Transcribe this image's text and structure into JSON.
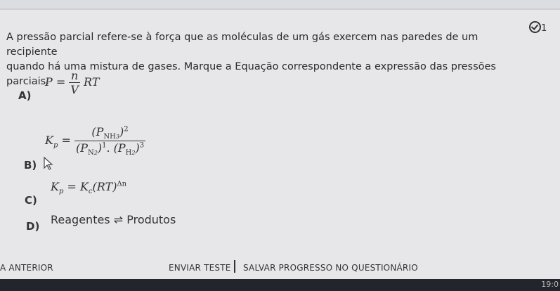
{
  "badge": {
    "count": "1"
  },
  "question": {
    "line1": "A pressão parcial refere-se à força que as moléculas de um gás exercem nas paredes de um recipiente",
    "line2": "quando há uma mistura de gases. Marque a Equação correspondente a expressão das pressões parciais:"
  },
  "options": {
    "a": {
      "letter": "A)",
      "lhs": "P =",
      "num": "n",
      "den": "V",
      "rhs": "RT"
    },
    "b": {
      "letter": "B)",
      "lhs": "K",
      "lhs_sub": "p",
      "eq": "=",
      "num_p": "(P",
      "num_sub": "NH",
      "num_sub2": "3",
      "num_close": ")",
      "num_sup": "2",
      "den_p1": "(P",
      "den_sub1": "N",
      "den_sub1b": "2",
      "den_close1": ")",
      "den_sup1": "1",
      "den_dot": ". ",
      "den_p2": "(P",
      "den_sub2": "H",
      "den_sub2b": "2",
      "den_close2": ")",
      "den_sup2": "3"
    },
    "c": {
      "letter": "C)",
      "lhs": "K",
      "lhs_sub": "p",
      "eq": "=",
      "k": "K",
      "k_sub": "c",
      "rt": "(RT)",
      "exp": "Δn"
    },
    "d": {
      "letter": "D)",
      "text": "Reagentes ⇌ Produtos"
    }
  },
  "footer": {
    "previous": "A ANTERIOR",
    "submit": "ENVIAR TESTE",
    "save": "SALVAR PROGRESSO NO QUESTIONÁRIO"
  },
  "taskbar": {
    "clock": "19:0"
  }
}
